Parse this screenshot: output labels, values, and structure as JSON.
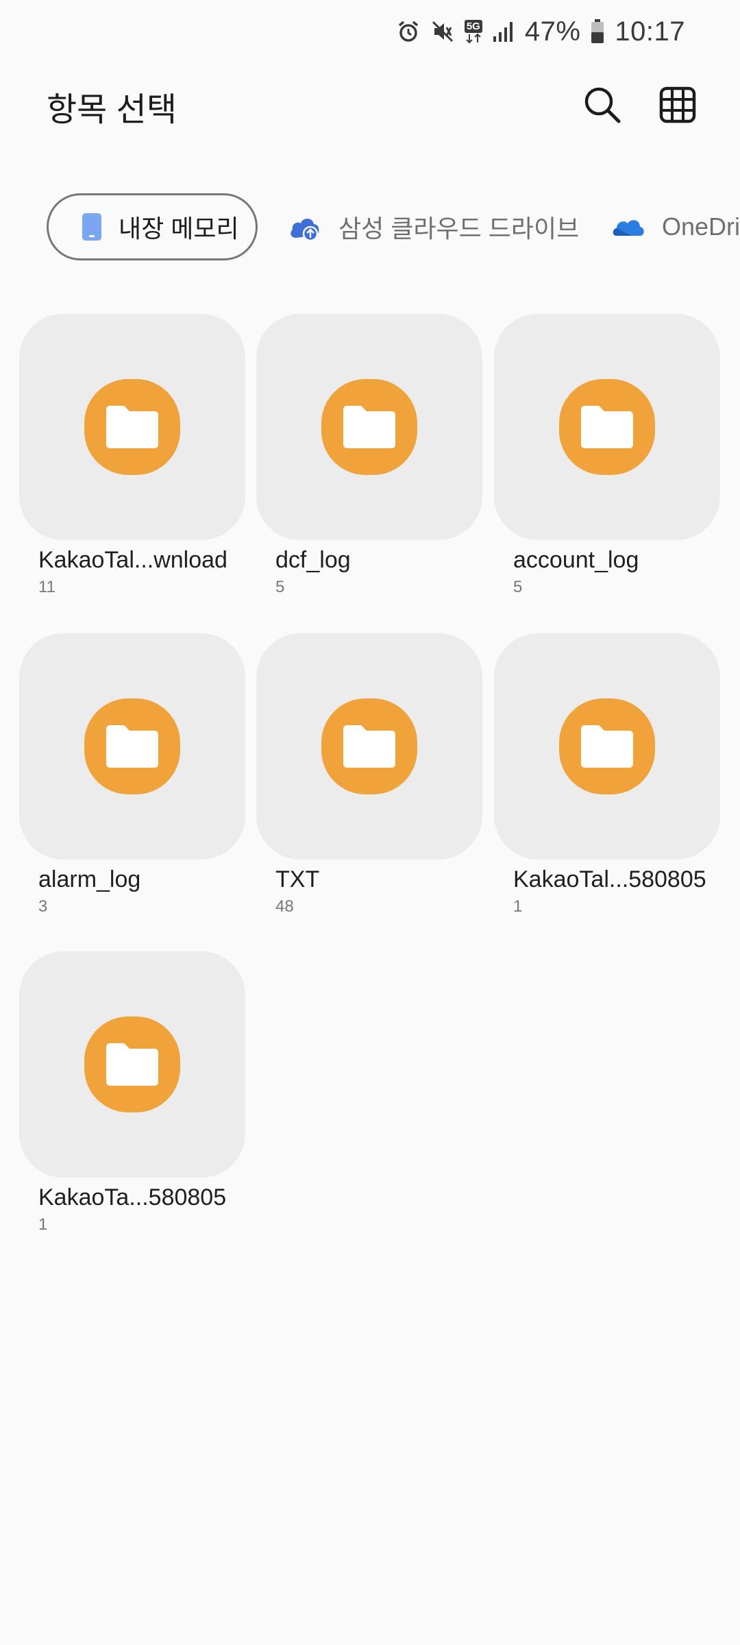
{
  "status_bar": {
    "battery": "47%",
    "time": "10:17",
    "network_badge": "5G",
    "icons": [
      "alarm-icon",
      "mute-vibrate-icon",
      "5g-icon",
      "signal-icon",
      "battery-icon"
    ]
  },
  "header": {
    "title": "항목 선택",
    "icons": [
      "search-icon",
      "grid-view-icon"
    ]
  },
  "storage_tabs": [
    {
      "label": "내장 메모리",
      "icon": "phone-storage-icon",
      "selected": true,
      "color": "#7aa7ef"
    },
    {
      "label": "삼성 클라우드 드라이브",
      "icon": "cloud-upload-icon",
      "selected": false,
      "color": "#3f6fd6"
    },
    {
      "label": "OneDriv",
      "icon": "onedrive-icon",
      "selected": false,
      "color": "#2a7de1"
    }
  ],
  "folders": [
    {
      "name": "KakaoTal...wnload",
      "count": "11"
    },
    {
      "name": "dcf_log",
      "count": "5"
    },
    {
      "name": "account_log",
      "count": "5"
    },
    {
      "name": "alarm_log",
      "count": "3"
    },
    {
      "name": "TXT",
      "count": "48"
    },
    {
      "name": "KakaoTal...580805",
      "count": "1"
    },
    {
      "name": "KakaoTa...580805",
      "count": "1"
    }
  ],
  "colors": {
    "folder_icon": "#f0a33b",
    "tile_background": "#ececec",
    "page_background": "#fafafa"
  }
}
